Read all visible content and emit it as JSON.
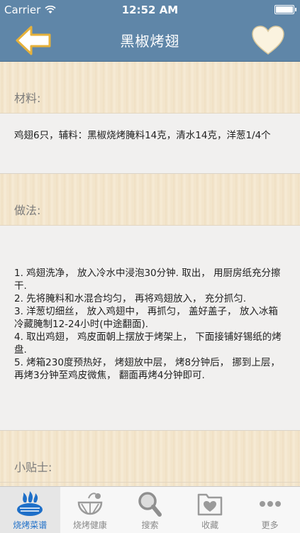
{
  "status_bar": {
    "carrier": "Carrier",
    "time": "12:52 AM"
  },
  "nav": {
    "title": "黑椒烤翅",
    "back_icon": "back-arrow-icon",
    "favorite_icon": "heart-icon"
  },
  "sections": {
    "materials": {
      "header": "材料:",
      "body": "鸡翅6只，辅料：黑椒烧烤腌料14克，清水14克，洋葱1/4个"
    },
    "method": {
      "header": "做法:",
      "body": "1. 鸡翅洗净， 放入冷水中浸泡30分钟. 取出， 用厨房纸充分擦干.\n2. 先将腌料和水混合均匀， 再将鸡翅放入， 充分抓匀.\n3. 洋葱切细丝， 放入鸡翅中， 再抓匀， 盖好盖子， 放入冰箱冷藏腌制12-24小时(中途翻面).\n4. 取出鸡翅， 鸡皮面朝上摆放于烤架上， 下面接铺好锡纸的烤盘.\n5. 烤箱230度预热好， 烤翅放中层， 烤8分钟后， 挪到上层， 再烤3分钟至鸡皮微焦， 翻面再烤4分钟即可."
    },
    "tips": {
      "header": "小贴士:"
    }
  },
  "tab_bar": {
    "active_color": "#1e6fc8",
    "items": [
      {
        "label": "烧烤菜谱",
        "icon": "grill-fire-icon",
        "active": true
      },
      {
        "label": "烧烤健康",
        "icon": "vegetable-icon",
        "active": false
      },
      {
        "label": "搜索",
        "icon": "search-icon",
        "active": false
      },
      {
        "label": "收藏",
        "icon": "favorites-folder-icon",
        "active": false
      },
      {
        "label": "更多",
        "icon": "more-icon",
        "active": false
      }
    ]
  }
}
